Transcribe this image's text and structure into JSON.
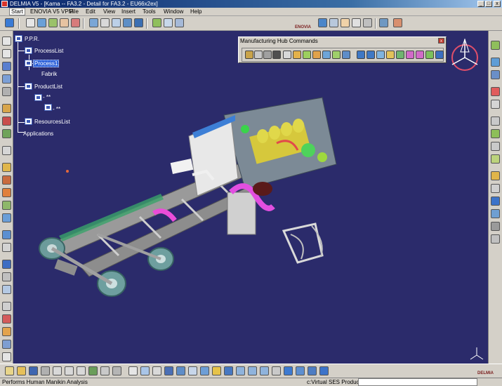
{
  "window": {
    "title": "DELMIA V5 - [Kama -- FA3.2 - Detail for FA3.2 - EU66x2ex]",
    "minimize": "_",
    "maximize": "□",
    "close": "x"
  },
  "menu": [
    "Start",
    "ENOVIA V5 VPM",
    "File",
    "Edit",
    "View",
    "Insert",
    "Tools",
    "Window",
    "Help"
  ],
  "brand": {
    "enovia": "ENOVIA",
    "delmia": "DELMIA"
  },
  "tree": {
    "root": "P.P.R.",
    "process_list": "ProcessList",
    "process1": "Process1",
    "fabrik": "Fabrik",
    "product_list": "ProductList",
    "item1": "- **",
    "item2": "- **",
    "resources_list": "ResourcesList",
    "applications": "Applications"
  },
  "hub": {
    "title": "Manufacturing Hub Commands",
    "close": "x"
  },
  "status": {
    "text": "Performs Human Manikin Analysis",
    "field": "c:Virtual SES Production",
    "input_value": ""
  },
  "icons": {
    "top": [
      "run-icon",
      "sheet-icon",
      "cog-sheet-icon",
      "wizard-icon",
      "table-icon",
      "tree-icon",
      "mesh-icon",
      "copy-icon",
      "paste-icon",
      "grid-icon",
      "camera-icon",
      "sim-icon",
      "doc-icon",
      "link-icon",
      "person-icon",
      "flag-icon",
      "cube-icon",
      "window-icon",
      "page-icon",
      "arrange-icon",
      "edit-icon"
    ],
    "hub": [
      "rail-icon",
      "tool-icon",
      "hammer-icon",
      "binoculars-icon",
      "cursor-icon",
      "bolt-icon",
      "swap-icon",
      "move-icon",
      "share-icon",
      "arrow-icon",
      "doc-icon",
      "grid-icon",
      "grid-icon",
      "filter-icon",
      "folder-icon",
      "connect-icon",
      "tag-icon",
      "tag-icon",
      "check-icon",
      "route-icon",
      "puzzle-icon",
      "export-icon"
    ]
  },
  "colors": {
    "viewport": "#2b2b6b",
    "title_active": "#0a246a",
    "selection": "#2e62d9"
  }
}
